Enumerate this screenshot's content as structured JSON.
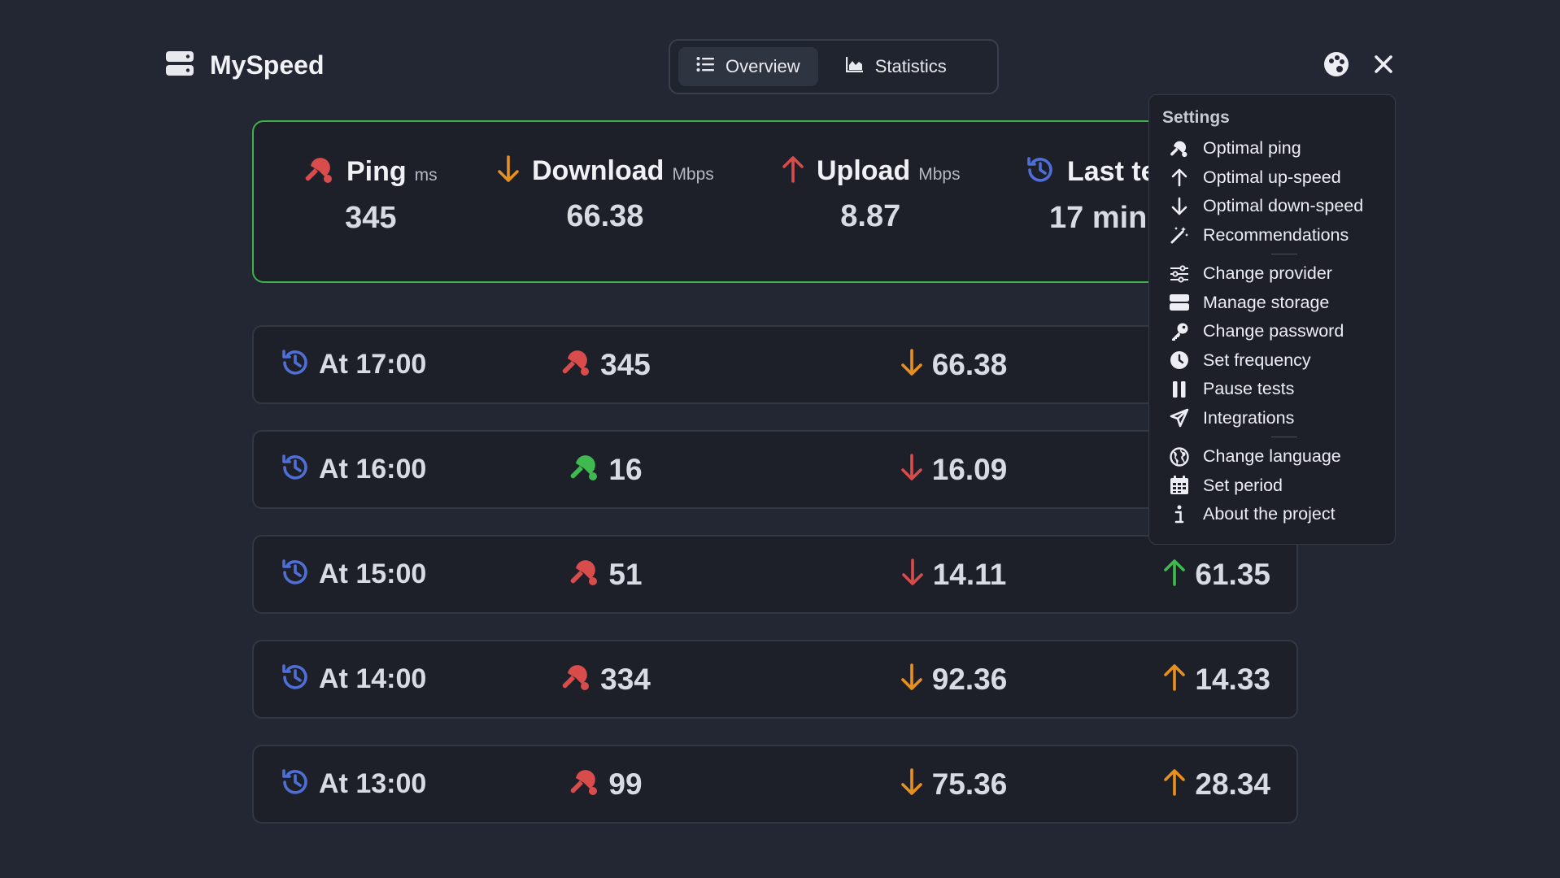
{
  "header": {
    "title": "MySpeed",
    "tabs": [
      {
        "label": "Overview",
        "active": true
      },
      {
        "label": "Statistics",
        "active": false
      }
    ]
  },
  "summary": {
    "ping": {
      "label": "Ping",
      "unit": "ms",
      "value": "345"
    },
    "download": {
      "label": "Download",
      "unit": "Mbps",
      "value": "66.38"
    },
    "upload": {
      "label": "Upload",
      "unit": "Mbps",
      "value": "8.87"
    },
    "last_test": {
      "label": "Last te",
      "value": "17 min"
    }
  },
  "rows": [
    {
      "time": "At 17:00",
      "ping": "345",
      "download": "66.38",
      "upload": "",
      "ping_color": "#d94c4c",
      "down_color": "#e8901f",
      "up_color": "#e8901f"
    },
    {
      "time": "At 16:00",
      "ping": "16",
      "download": "16.09",
      "upload": "",
      "ping_color": "#3fba4f",
      "down_color": "#d94c4c",
      "up_color": "#e8901f"
    },
    {
      "time": "At 15:00",
      "ping": "51",
      "download": "14.11",
      "upload": "61.35",
      "ping_color": "#d94c4c",
      "down_color": "#d94c4c",
      "up_color": "#3fba4f"
    },
    {
      "time": "At 14:00",
      "ping": "334",
      "download": "92.36",
      "upload": "14.33",
      "ping_color": "#d94c4c",
      "down_color": "#e8901f",
      "up_color": "#e8901f"
    },
    {
      "time": "At 13:00",
      "ping": "99",
      "download": "75.36",
      "upload": "28.34",
      "ping_color": "#d94c4c",
      "down_color": "#e8901f",
      "up_color": "#e8901f"
    }
  ],
  "menu": {
    "title": "Settings",
    "groups": [
      [
        {
          "label": "Optimal ping",
          "icon": "ping-pong-icon"
        },
        {
          "label": "Optimal up-speed",
          "icon": "arrow-up-icon"
        },
        {
          "label": "Optimal down-speed",
          "icon": "arrow-down-icon"
        },
        {
          "label": "Recommendations",
          "icon": "magic-wand-icon"
        }
      ],
      [
        {
          "label": "Change provider",
          "icon": "sliders-icon"
        },
        {
          "label": "Manage storage",
          "icon": "storage-icon"
        },
        {
          "label": "Change password",
          "icon": "key-icon"
        },
        {
          "label": "Set frequency",
          "icon": "clock-icon"
        },
        {
          "label": "Pause tests",
          "icon": "pause-icon"
        },
        {
          "label": "Integrations",
          "icon": "send-icon"
        }
      ],
      [
        {
          "label": "Change language",
          "icon": "globe-icon"
        },
        {
          "label": "Set period",
          "icon": "calendar-icon"
        },
        {
          "label": "About the project",
          "icon": "info-icon"
        }
      ]
    ]
  },
  "colors": {
    "accent_blue": "#4f6fd6",
    "good": "#3fba4f",
    "bad": "#d94c4c",
    "warn": "#e8901f"
  }
}
